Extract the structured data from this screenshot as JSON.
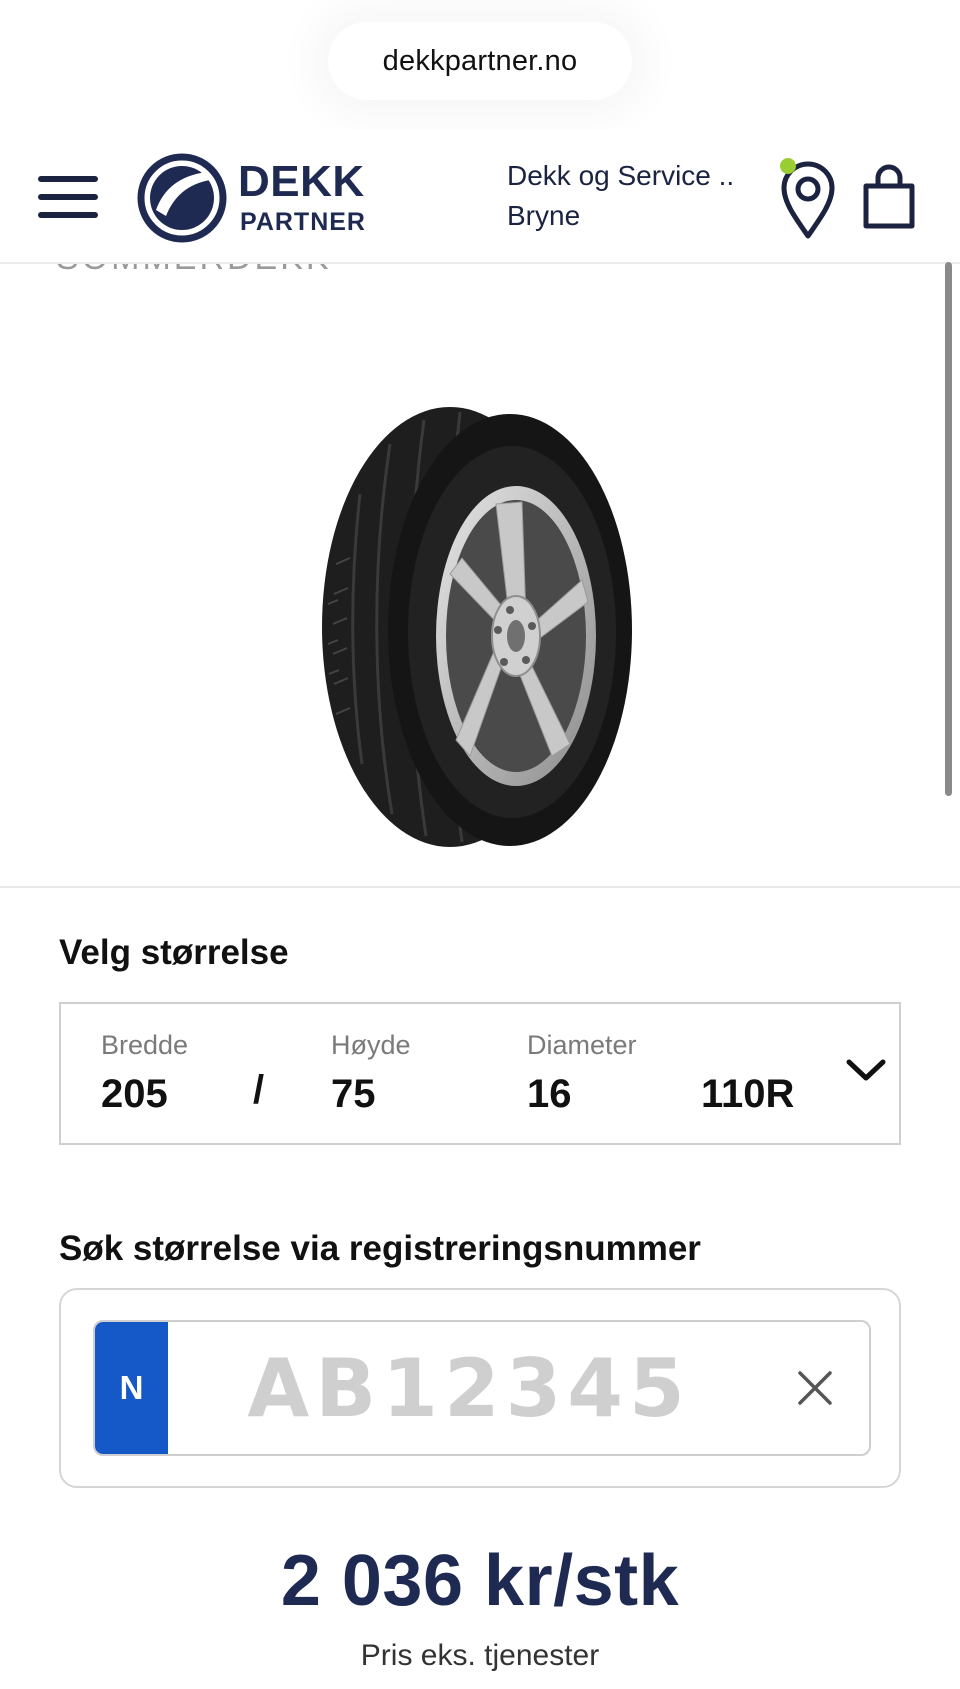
{
  "browser": {
    "url": "dekkpartner.no"
  },
  "header": {
    "logo_line1": "DEKK",
    "logo_line2": "PARTNER",
    "store_line1": "Dekk og Service ..",
    "store_line2": "Bryne",
    "icons": [
      "menu-icon",
      "location-pin-icon",
      "shopping-bag-icon"
    ],
    "location_badge_color": "#9acd32"
  },
  "product": {
    "category": "SOMMERDEKK"
  },
  "size_selector": {
    "title": "Velg størrelse",
    "width_label": "Bredde",
    "width_value": "205",
    "separator": "/",
    "height_label": "Høyde",
    "height_value": "75",
    "diameter_label": "Diameter",
    "diameter_value": "16",
    "load_speed": "110R"
  },
  "registration": {
    "title": "Søk størrelse via registreringsnummer",
    "country_code": "N",
    "placeholder": "AB12345",
    "flag_color": "#1558c7"
  },
  "price": {
    "amount": "2 036 kr/stk",
    "note": "Pris eks. tjenester"
  },
  "colors": {
    "brand_navy": "#1e2a52"
  }
}
